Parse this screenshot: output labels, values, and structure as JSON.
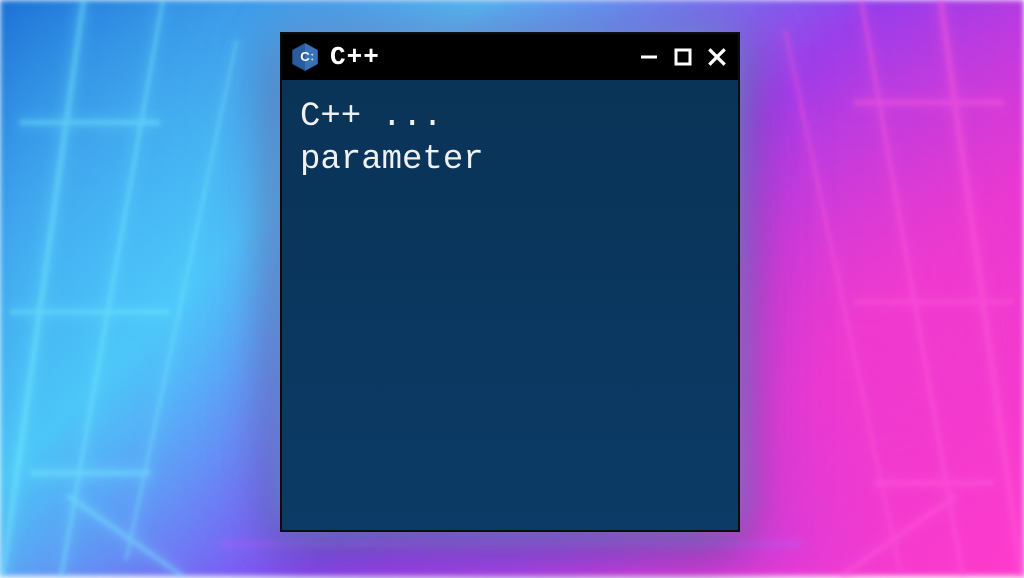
{
  "window": {
    "title": "C++",
    "icon_name": "cpp-hex-icon"
  },
  "content": {
    "text": "C++ ...\nparameter"
  }
}
